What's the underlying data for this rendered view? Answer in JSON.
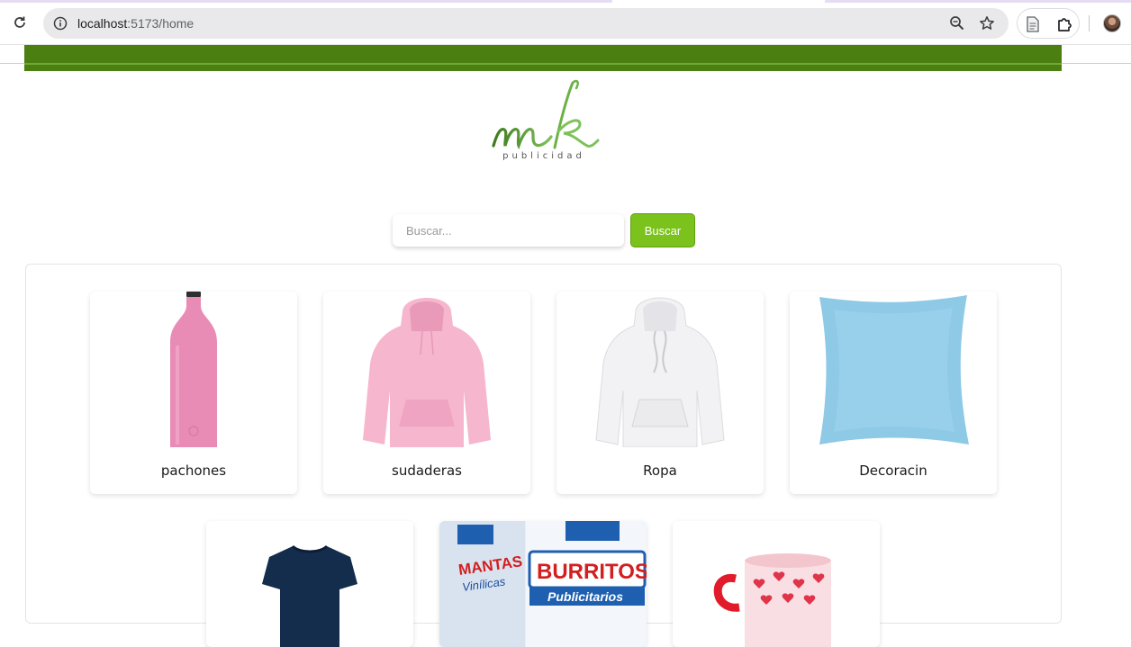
{
  "browser": {
    "url_host": "localhost",
    "url_path": ":5173/home"
  },
  "brand": {
    "logo_text": "mk",
    "logo_subtext": "publicidad",
    "band_color": "#4c7f12",
    "accent_color": "#7cc21d"
  },
  "search": {
    "placeholder": "Buscar...",
    "button_label": "Buscar"
  },
  "categories": [
    {
      "label": "pachones",
      "icon": "pink-bottle-image"
    },
    {
      "label": "sudaderas",
      "icon": "pink-hoodie-image"
    },
    {
      "label": "Ropa",
      "icon": "white-hoodie-image"
    },
    {
      "label": "Decoracin",
      "icon": "blue-pillow-image"
    },
    {
      "label": "",
      "icon": "navy-tshirt-image"
    },
    {
      "label": "",
      "icon": "banner-flyer-image",
      "image_text": [
        "MANTAS",
        "Vinílicas",
        "BURRITOS",
        "Publicitarios"
      ]
    },
    {
      "label": "",
      "icon": "heart-mug-image"
    }
  ]
}
